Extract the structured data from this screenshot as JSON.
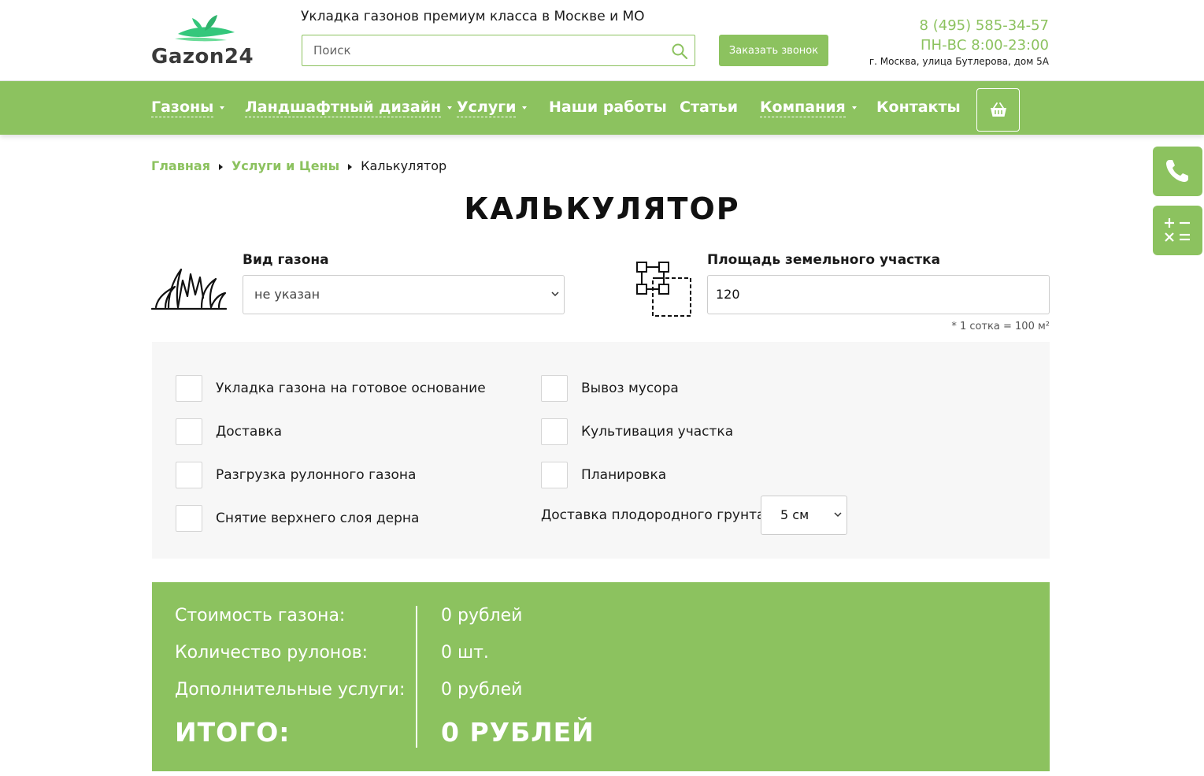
{
  "header": {
    "logo_text": "Gazon24",
    "tagline": "Укладка газонов премиум класса в Москве и МО",
    "search_placeholder": "Поиск",
    "callback_label": "Заказать звонок",
    "phone": "8 (495) 585-34-57",
    "hours": "ПН-ВС 8:00-23:00",
    "address": "г. Москва, улица Бутлерова, дом 5А"
  },
  "nav": {
    "items": [
      {
        "label": "Газоны",
        "dropdown": true
      },
      {
        "label": "Ландшафтный дизайн",
        "dropdown": true
      },
      {
        "label": "Услуги",
        "dropdown": true
      },
      {
        "label": "Наши работы",
        "dropdown": false
      },
      {
        "label": "Статьи",
        "dropdown": false
      },
      {
        "label": "Компания",
        "dropdown": true
      },
      {
        "label": "Контакты",
        "dropdown": false
      }
    ],
    "cart_icon": "basket-icon"
  },
  "side_buttons": [
    {
      "icon": "phone-icon"
    },
    {
      "icon": "calculator-icon"
    }
  ],
  "breadcrumb": {
    "home": "Главная",
    "section": "Услуги и Цены",
    "current": "Калькулятор"
  },
  "page_title": "КАЛЬКУЛЯТОР",
  "form": {
    "lawn_type_label": "Вид газона",
    "lawn_type_value": "не указан",
    "area_label": "Площадь земельного участка",
    "area_value": "120",
    "area_note": "* 1 сотка = 100 м²"
  },
  "options": {
    "left": [
      "Укладка газона на готовое основание",
      "Доставка",
      "Разгрузка рулонного газона",
      "Снятие верхнего слоя дерна"
    ],
    "right": [
      "Вывоз мусора",
      "Культивация участка",
      "Планировка"
    ],
    "soil_label": "Доставка плодородного грунта",
    "soil_value": "5 см"
  },
  "results": {
    "lawn_cost_label": "Стоимость газона:",
    "lawn_cost_value": "0 рублей",
    "rolls_label": "Количество рулонов:",
    "rolls_value": "0 шт.",
    "extra_label": "Дополнительные услуги:",
    "extra_value": "0 рублей",
    "total_label": "ИТОГО:",
    "total_value": "0 РУБЛЕЙ"
  },
  "colors": {
    "accent": "#8cc25f",
    "text": "#1a1a1a",
    "panel": "#f7f7f7"
  }
}
